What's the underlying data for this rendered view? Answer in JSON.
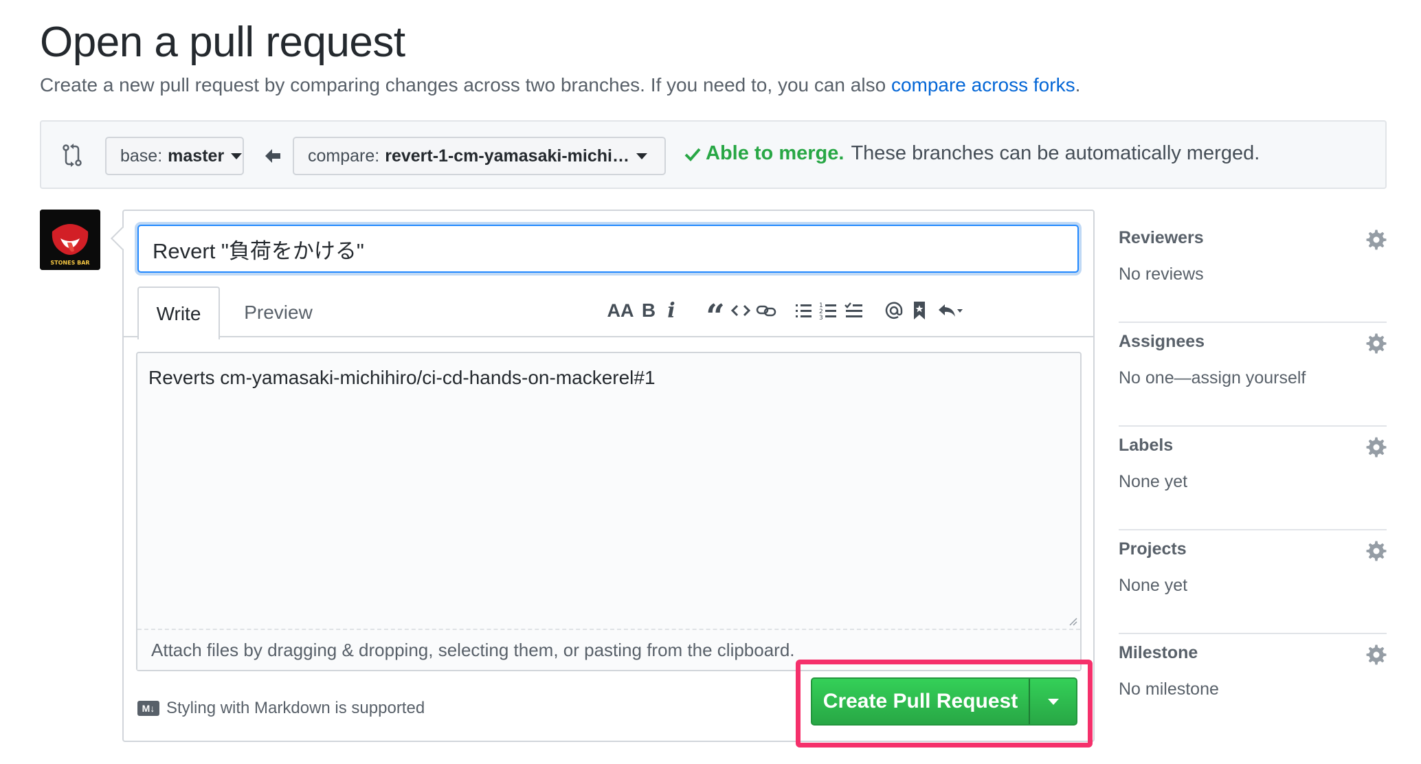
{
  "header": {
    "title": "Open a pull request",
    "subtitle": "Create a new pull request by comparing changes across two branches. If you need to, you can also ",
    "subtitle_link": "compare across forks",
    "subtitle_end": "."
  },
  "range": {
    "base_prefix": "base:",
    "base_value": "master",
    "compare_prefix": "compare:",
    "compare_value": "revert-1-cm-yamasaki-michi…",
    "merge_ok": "Able to merge.",
    "merge_msg": "These branches can be automatically merged."
  },
  "composer": {
    "title_value": "Revert \"負荷をかける\"",
    "tab_write": "Write",
    "tab_preview": "Preview",
    "body": "Reverts cm-yamasaki-michihiro/ci-cd-hands-on-mackerel#1",
    "attach_hint": "Attach files by dragging & dropping, selecting them, or pasting from the clipboard.",
    "markdown_hint": "Styling with Markdown is supported",
    "markdown_icon_label": "M↓",
    "submit_label": "Create Pull Request"
  },
  "toolbar": {
    "heading": "AA",
    "bold": "B",
    "italic": "i",
    "quote": "“"
  },
  "sidebar": {
    "reviewers": {
      "title": "Reviewers",
      "value": "No reviews"
    },
    "assignees": {
      "title": "Assignees",
      "value": "No one—assign yourself"
    },
    "labels": {
      "title": "Labels",
      "value": "None yet"
    },
    "projects": {
      "title": "Projects",
      "value": "None yet"
    },
    "milestone": {
      "title": "Milestone",
      "value": "No milestone"
    }
  },
  "colors": {
    "accent": "#0366d6",
    "success": "#28a745",
    "highlight": "#f5306b"
  }
}
